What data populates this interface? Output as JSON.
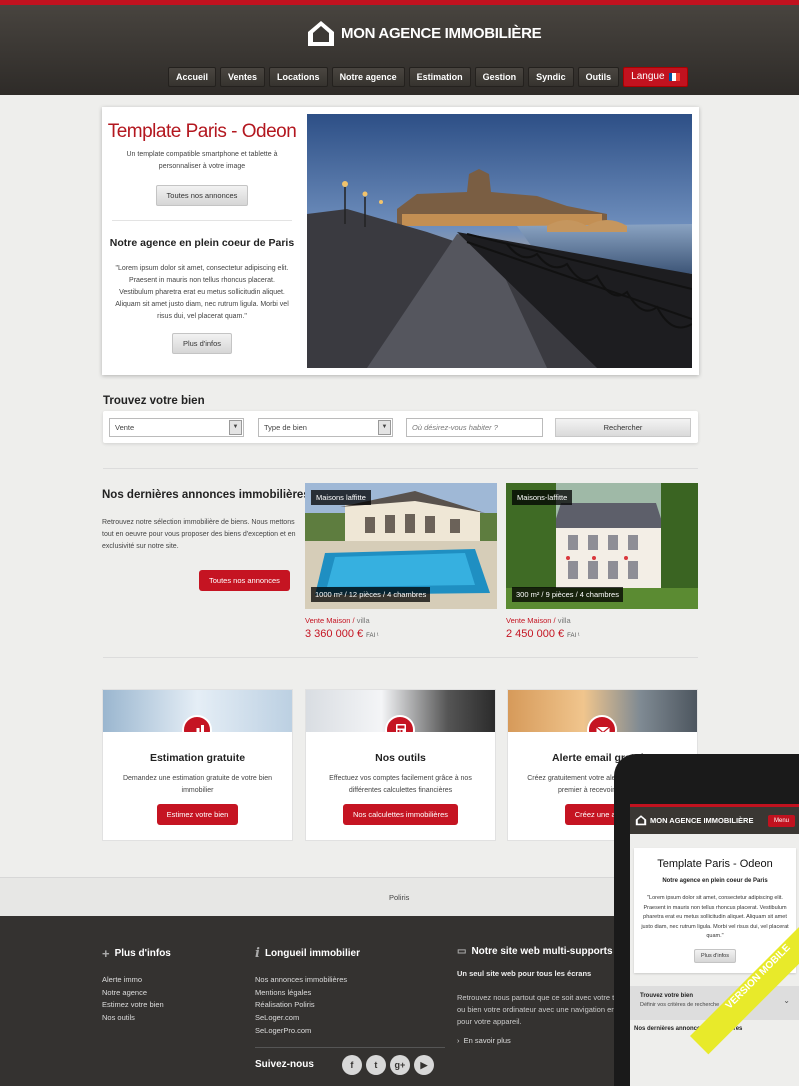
{
  "brand": {
    "name": "MON AGENCE IMMOBILIÈRE",
    "accent": "#c1121f"
  },
  "nav": {
    "items": [
      "Accueil",
      "Ventes",
      "Locations",
      "Notre agence",
      "Estimation",
      "Gestion",
      "Syndic",
      "Outils"
    ],
    "language": "Langue"
  },
  "hero": {
    "title": "Template Paris - Odeon",
    "subtitle": "Un template compatible smartphone et tablette à personnaliser à votre image",
    "all_button": "Toutes nos annonces",
    "heading": "Notre agence en plein coeur de Paris",
    "text": "\"Lorem ipsum dolor sit amet, consectetur adipiscing elit. Praesent in mauris non tellus rhoncus placerat. Vestibulum pharetra erat eu metus sollicitudin aliquet. Aliquam sit amet justo diam, nec rutrum ligula. Morbi vel risus dui, vel placerat quam.\"",
    "more_button": "Plus d'infos"
  },
  "search": {
    "title": "Trouvez votre bien",
    "transaction_value": "Vente",
    "type_placeholder": "Type de bien",
    "location_placeholder": "Où désirez-vous habiter ?",
    "button": "Rechercher"
  },
  "latest": {
    "title": "Nos dernières annonces immobilières",
    "text": "Retrouvez notre sélection immobilière de biens. Nous mettons tout en oeuvre pour vous proposer des biens d'exception et en exclusivité sur notre site.",
    "button": "Toutes nos annonces",
    "listings": [
      {
        "tag": "Maisons laffitte",
        "spec": "1000 m² / 12 pièces / 4 chambres",
        "type": "Vente Maison",
        "subtype": "villa",
        "price": "3 360 000 €",
        "fai": "FAI ¹"
      },
      {
        "tag": "Maisons-laffitte",
        "spec": "300 m² / 9 pièces / 4 chambres",
        "type": "Vente Maison",
        "subtype": "villa",
        "price": "2 450 000 €",
        "fai": "FAI ¹"
      }
    ]
  },
  "features": [
    {
      "title": "Estimation gratuite",
      "text": "Demandez une estimation gratuite de votre bien immobilier",
      "button": "Estimez votre bien",
      "icon": "chart-icon"
    },
    {
      "title": "Nos outils",
      "text": "Effectuez vos comptes facilement grâce à nos différentes calculettes financières",
      "button": "Nos calculettes immobilières",
      "icon": "calculator-icon"
    },
    {
      "title": "Alerte email gratuite",
      "text": "Créez gratuitement votre alerte email et soyez le premier à recevoir nos offres",
      "button": "Créez une alerte",
      "icon": "mail-icon"
    }
  ],
  "poliris": "Poliris",
  "footer": {
    "col1": {
      "title": "Plus d'infos",
      "links": [
        "Alerte immo",
        "Notre agence",
        "Estimez votre bien",
        "Nos outils"
      ]
    },
    "col2": {
      "title": "Longueil immobilier",
      "links": [
        "Nos annonces immobilières",
        "Mentions légales",
        "Réalisation Poliris",
        "SeLoger.com",
        "SeLogerPro.com"
      ],
      "follow": "Suivez-nous"
    },
    "col3": {
      "title": "Notre site web multi-supports",
      "strong": "Un seul site web pour tous les écrans",
      "text": "Retrouvez nous partout que ce soit avec votre tablette ou bien votre ordinateur avec une navigation enrichie pour votre appareil.",
      "more": "En savoir plus"
    }
  },
  "mobile": {
    "logo": "MON AGENCE IMMOBILIÈRE",
    "menu": "Menu",
    "title": "Template Paris - Odeon",
    "heading": "Notre agence en plein coeur de Paris",
    "text": "\"Lorem ipsum dolor sit amet, consectetur adipiscing elit. Praesent in mauris non tellus rhoncus placerat. Vestibulum pharetra erat eu metus sollicitudin aliquet. Aliquam sit amet justo diam, nec rutrum ligula. Morbi vel risus dui, vel placerat quam.\"",
    "more": "Plus d'infos",
    "find_title": "Trouvez votre bien",
    "find_sub": "Définir vos critères de recherche",
    "latest": "Nos dernières annonces immobilières",
    "ribbon": "VERSION MOBILE"
  }
}
